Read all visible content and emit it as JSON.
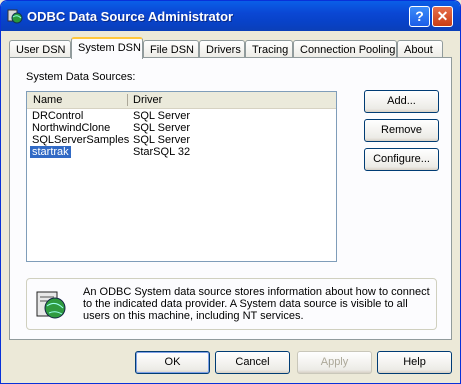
{
  "window": {
    "title": "ODBC Data Source Administrator"
  },
  "tabs": [
    {
      "label": "User DSN"
    },
    {
      "label": "System DSN"
    },
    {
      "label": "File DSN"
    },
    {
      "label": "Drivers"
    },
    {
      "label": "Tracing"
    },
    {
      "label": "Connection Pooling"
    },
    {
      "label": "About"
    }
  ],
  "panel": {
    "list_label": "System Data Sources:",
    "columns": [
      "Name",
      "Driver"
    ],
    "rows": [
      {
        "name": "DRControl",
        "driver": "SQL Server"
      },
      {
        "name": "NorthwindClone",
        "driver": "SQL Server"
      },
      {
        "name": "SQLServerSamples",
        "driver": "SQL Server"
      },
      {
        "name": "startrak",
        "driver": "StarSQL 32",
        "selected": true
      }
    ],
    "buttons": {
      "add": "Add...",
      "remove": "Remove",
      "configure": "Configure..."
    },
    "info_text": "An ODBC System data source stores information about how to connect to the indicated data provider.   A System data source is visible to all users on this machine, including NT services."
  },
  "footer": {
    "ok": "OK",
    "cancel": "Cancel",
    "apply": "Apply",
    "help": "Help"
  },
  "icons": {
    "title": "odbc-globe-icon",
    "info": "database-globe-icon"
  }
}
